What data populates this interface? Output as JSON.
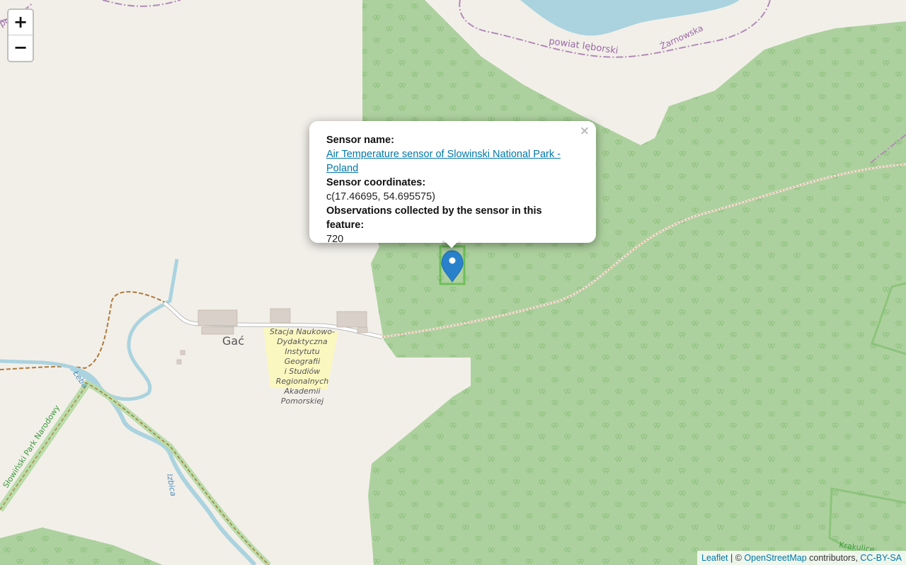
{
  "zoom": {
    "in_label": "+",
    "out_label": "−"
  },
  "map_labels": {
    "county": "powiat lęborski",
    "road_top": "Żarnowska",
    "village": "Gać",
    "station": [
      "Stacja Naukowo-",
      "Dydaktyczna",
      "Instytutu",
      "Geografii",
      "i Studiów",
      "Regionalnych",
      "Akademii",
      "Pomorskiej"
    ],
    "park": "Słowiński Park Narodowy",
    "river_leba": "Łeba",
    "river_izbica": "Izbica",
    "krakulice": "Krakulice",
    "corner": "powi"
  },
  "popup": {
    "close": "×",
    "name_label": "Sensor name:",
    "name_value": "Air Temperature sensor of Slowinski National Park - Poland",
    "coords_label": "Sensor coordinates:",
    "coords_value": "c(17.46695, 54.695575)",
    "obs_label": "Observations collected by the sensor in this feature:",
    "obs_value": "720"
  },
  "marker": {
    "color": "#2a81cb",
    "longitude": 17.46695,
    "latitude": 54.695575
  },
  "attribution": {
    "leaflet": "Leaflet",
    "sep": " | © ",
    "osm": "OpenStreetMap",
    "contributors": " contributors, ",
    "license": "CC-BY-SA"
  },
  "colors": {
    "land": "#f2efe9",
    "forest": "#add19e",
    "water": "#aad3df",
    "boundary": "#ac46ac",
    "park_boundary": "#7fbf6f"
  }
}
